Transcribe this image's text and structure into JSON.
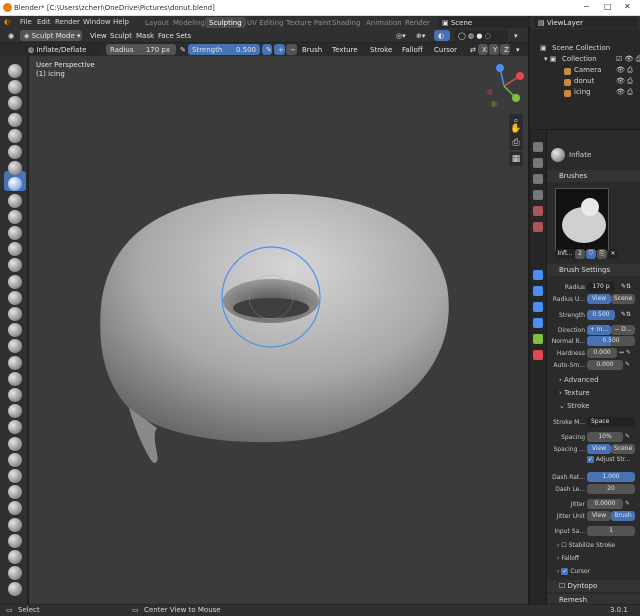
{
  "window": {
    "title": "Blender* [C:\\Users\\zcheri\\OneDrive\\Pictures\\donut.blend]",
    "controls": [
      "─",
      "□",
      "✕"
    ]
  },
  "menu": [
    "File",
    "Edit",
    "Render",
    "Window",
    "Help"
  ],
  "workspaces": [
    "Layout",
    "Modeling",
    "Sculpting",
    "UV Editing",
    "Texture Paint",
    "Shading",
    "Animation",
    "Render"
  ],
  "active_workspace": "Sculpting",
  "scene": "Scene",
  "viewlayer": "ViewLayer",
  "header": {
    "mode": "Sculpt Mode",
    "menus": [
      "View",
      "Sculpt",
      "Mask",
      "Face Sets"
    ],
    "axes": [
      "X",
      "Y",
      "Z"
    ]
  },
  "toolsettings": {
    "brush": "Inflate/Deflate",
    "radius_label": "Radius",
    "radius_value": "170 px",
    "strength_label": "Strength",
    "strength_value": "0.500",
    "dropdowns": [
      "Brush",
      "Texture",
      "Stroke",
      "Falloff",
      "Cursor"
    ]
  },
  "viewport": {
    "view_name": "User Perspective",
    "object_label": "(1) icing"
  },
  "outliner": {
    "root": "Scene Collection",
    "collection": "Collection",
    "items": [
      "Camera",
      "donut",
      "icing"
    ]
  },
  "properties": {
    "tool_name": "Inflate",
    "brushes_panel": "Brushes",
    "brush_short": "Infl...",
    "brush_users": "2",
    "brush_settings_panel": "Brush Settings",
    "radius_label": "Radius",
    "radius_value": "170 p",
    "radius_unit_label": "Radius U...",
    "radius_unit_options": [
      "View",
      "Scene"
    ],
    "strength_label": "Strength",
    "strength_value": "0.500",
    "direction_label": "Direction",
    "direction_options": [
      "+ In...",
      "− D..."
    ],
    "normal_radius_label": "Normal R...",
    "normal_radius_value": "0.500",
    "hardness_label": "Hardness",
    "hardness_value": "0.000",
    "autosmooth_label": "Auto-Sm...",
    "autosmooth_value": "0.000",
    "subpanels": [
      "Advanced",
      "Texture",
      "Stroke"
    ],
    "stroke_method_label": "Stroke M...",
    "stroke_method_value": "Space",
    "spacing_label": "Spacing",
    "spacing_value": "10%",
    "spacing_dist_label": "Spacing ...",
    "spacing_dist_options": [
      "View",
      "Scene"
    ],
    "adjust_stroke": "Adjust Str...",
    "dash_ratio_label": "Dash Rat...",
    "dash_ratio_value": "1.000",
    "dash_length_label": "Dash Le...",
    "dash_length_value": "20",
    "jitter_label": "Jitter",
    "jitter_value": "0.0000",
    "jitter_unit_label": "Jitter Unit",
    "jitter_unit_options": [
      "View",
      "Brush"
    ],
    "input_samples_label": "Input Sa...",
    "input_samples_value": "1",
    "stabilize": "Stabilize Stroke",
    "falloff": "Falloff",
    "cursor": "Cursor",
    "dyntopo": "Dyntopo",
    "remesh": "Remesh"
  },
  "status": {
    "left": "Select",
    "middle": "Center View to Mouse",
    "version": "3.0.1"
  },
  "colors": {
    "accent": "#4772b3",
    "viewport_bg": "#3b3b3b",
    "panel": "#2b2b2b",
    "x_axis": "#e34850",
    "y_axis": "#7fbf3f",
    "z_axis": "#4c8ff2"
  }
}
